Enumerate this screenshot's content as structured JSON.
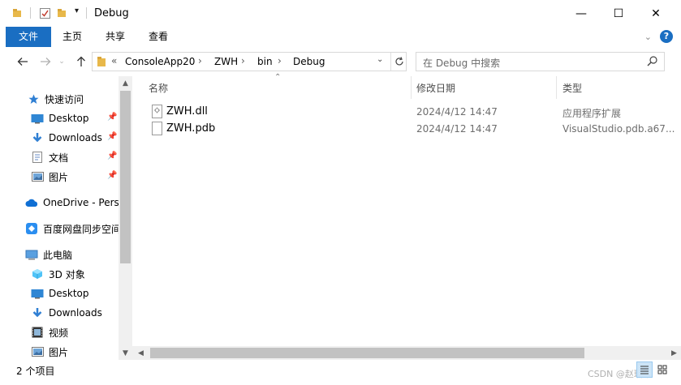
{
  "window": {
    "title": "Debug",
    "minimize_glyph": "—",
    "maximize_glyph": "☐",
    "close_glyph": "✕"
  },
  "ribbon": {
    "tabs": [
      "文件",
      "主页",
      "共享",
      "查看"
    ],
    "help_glyph": "?"
  },
  "address": {
    "overflow": "«",
    "crumbs": [
      "ConsoleApp20",
      "ZWH",
      "bin",
      "Debug"
    ]
  },
  "search": {
    "placeholder": "在 Debug 中搜索"
  },
  "nav": {
    "items": [
      {
        "label": "快速访问",
        "icon": "star-icon",
        "pinned": false
      },
      {
        "label": "Desktop",
        "icon": "desktop-icon",
        "pinned": true
      },
      {
        "label": "Downloads",
        "icon": "download-icon",
        "pinned": true
      },
      {
        "label": "文档",
        "icon": "document-icon",
        "pinned": true
      },
      {
        "label": "图片",
        "icon": "picture-icon",
        "pinned": true
      },
      {
        "label": "OneDrive - Perso",
        "icon": "cloud-icon",
        "pinned": false
      },
      {
        "label": "百度网盘同步空间",
        "icon": "baidu-netdisk-icon",
        "pinned": false
      },
      {
        "label": "此电脑",
        "icon": "computer-icon",
        "pinned": false
      },
      {
        "label": "3D 对象",
        "icon": "cube-icon",
        "pinned": false
      },
      {
        "label": "Desktop",
        "icon": "desktop-icon",
        "pinned": false
      },
      {
        "label": "Downloads",
        "icon": "download-icon",
        "pinned": false
      },
      {
        "label": "视频",
        "icon": "video-icon",
        "pinned": false
      },
      {
        "label": "图片",
        "icon": "picture-icon",
        "pinned": false
      }
    ]
  },
  "columns": {
    "name": "名称",
    "modified": "修改日期",
    "type": "类型"
  },
  "files": [
    {
      "name": "ZWH.dll",
      "modified": "2024/4/12 14:47",
      "type": "应用程序扩展",
      "icon": "dll-file-icon"
    },
    {
      "name": "ZWH.pdb",
      "modified": "2024/4/12 14:47",
      "type": "VisualStudio.pdb.a67...",
      "icon": "file-icon"
    }
  ],
  "status": {
    "count": "2 个项目",
    "watermark": "CSDN @赵瑞希"
  },
  "colors": {
    "accent": "#1a6ec2",
    "selection": "#cce4f7"
  }
}
